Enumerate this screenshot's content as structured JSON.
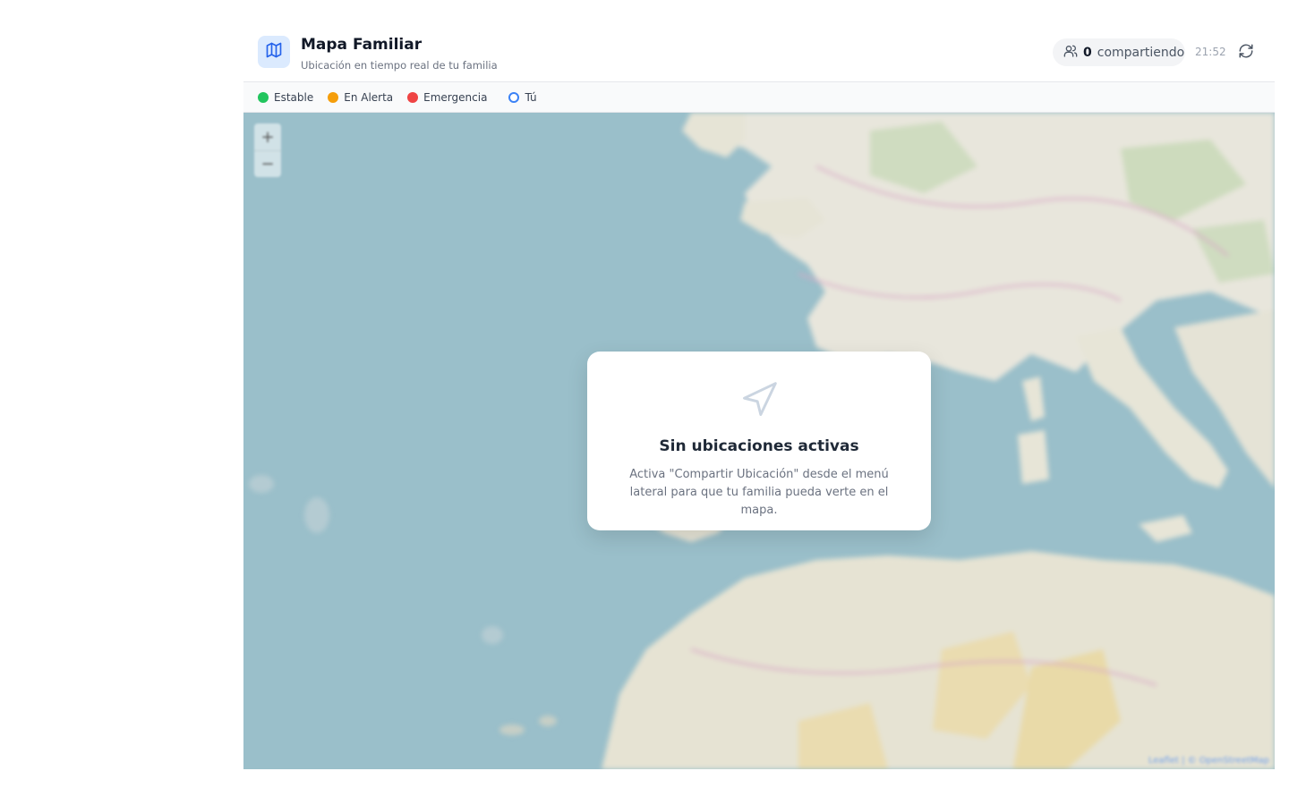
{
  "header": {
    "title": "Mapa Familiar",
    "subtitle": "Ubicación en tiempo real de tu familia",
    "logo_icon": "map-icon",
    "sharing_count": "0",
    "sharing_label": "compartiendo",
    "time": "21:52",
    "refresh_icon": "refresh-icon"
  },
  "legend": {
    "items": [
      {
        "label": "Estable",
        "color": "#22c55e"
      },
      {
        "label": "En Alerta",
        "color": "#f59e0b"
      },
      {
        "label": "Emergencia",
        "color": "#ef4444"
      },
      {
        "label": "Tú",
        "color": "#3b82f6"
      }
    ]
  },
  "map": {
    "zoom_in": "+",
    "zoom_out": "−",
    "attribution": "Leaflet | © OpenStreetMap"
  },
  "empty_state": {
    "icon": "navigation-arrow-icon",
    "title": "Sin ubicaciones activas",
    "message": "Activa \"Compartir Ubicación\" desde el menú lateral para que tu familia pueda verte en el mapa."
  }
}
